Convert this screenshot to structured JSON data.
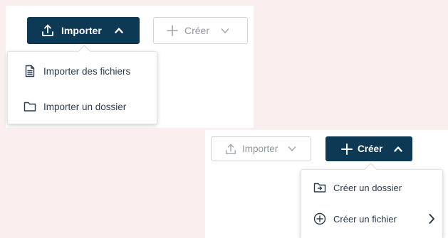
{
  "scene_a": {
    "import_button": {
      "label": "Importer",
      "icon": "upload-icon",
      "chevron": "chevron-up-icon",
      "state": "active"
    },
    "create_button": {
      "label": "Créer",
      "icon": "plus-icon",
      "chevron": "chevron-down-icon",
      "state": "disabled"
    },
    "import_menu": {
      "items": [
        {
          "label": "Importer des fichiers",
          "icon": "file-icon"
        },
        {
          "label": "Importer un dossier",
          "icon": "folder-icon"
        }
      ]
    }
  },
  "scene_b": {
    "import_button": {
      "label": "Importer",
      "icon": "upload-icon",
      "chevron": "chevron-down-icon",
      "state": "disabled"
    },
    "create_button": {
      "label": "Créer",
      "icon": "plus-icon",
      "chevron": "chevron-up-icon",
      "state": "active"
    },
    "create_menu": {
      "items": [
        {
          "label": "Créer un dossier",
          "icon": "folder-plus-icon"
        },
        {
          "label": "Créer un fichier",
          "icon": "plus-circle-icon",
          "submenu_icon": "chevron-right-icon"
        }
      ]
    }
  },
  "colors": {
    "background": "#fbeeee",
    "primary": "#0d3954",
    "disabled_text": "#8e969e",
    "menu_text": "#2b3a4a"
  }
}
